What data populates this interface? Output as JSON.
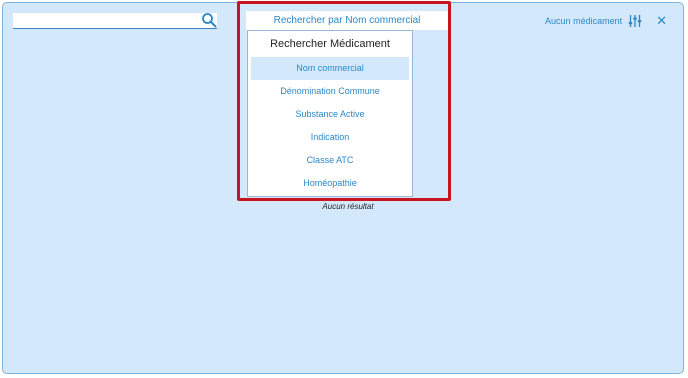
{
  "search": {
    "value": "",
    "icon": "search-icon"
  },
  "mode": {
    "label": "Rechercher par Nom commercial"
  },
  "dropdown": {
    "title": "Rechercher Médicament",
    "items": [
      {
        "label": "Nom commercial",
        "selected": true
      },
      {
        "label": "Dénomination Commune",
        "selected": false
      },
      {
        "label": "Substance Active",
        "selected": false
      },
      {
        "label": "Indication",
        "selected": false
      },
      {
        "label": "Classe ATC",
        "selected": false
      },
      {
        "label": "Homéopathie",
        "selected": false
      }
    ]
  },
  "results": {
    "empty_label": "Aucun résultat"
  },
  "header_right": {
    "no_med_label": "Aucun médicament",
    "filter_icon": "sliders-icon",
    "close_icon": "close-icon",
    "close_glyph": "✕"
  },
  "colors": {
    "panel_bg": "#d4e8fb",
    "accent": "#2a88c8",
    "highlight": "#c8141f"
  }
}
